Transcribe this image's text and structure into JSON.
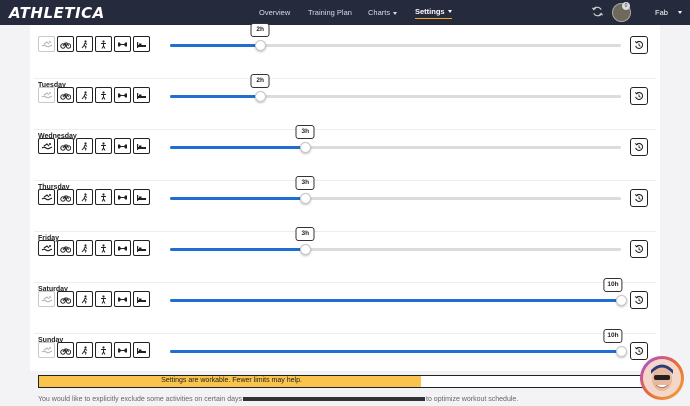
{
  "brand": "ATHLETICA",
  "nav": {
    "overview": "Overview",
    "training_plan": "Training Plan",
    "charts": "Charts",
    "settings": "Settings",
    "username": "Fab",
    "notification_count": "0"
  },
  "days": [
    {
      "name": "",
      "hours_label": "2h",
      "hours": 2,
      "swim_enabled": false
    },
    {
      "name": "Tuesday",
      "hours_label": "2h",
      "hours": 2,
      "swim_enabled": false
    },
    {
      "name": "Wednesday",
      "hours_label": "3h",
      "hours": 3,
      "swim_enabled": true
    },
    {
      "name": "Thursday",
      "hours_label": "3h",
      "hours": 3,
      "swim_enabled": true
    },
    {
      "name": "Friday",
      "hours_label": "3h",
      "hours": 3,
      "swim_enabled": true
    },
    {
      "name": "Saturday",
      "hours_label": "10h",
      "hours": 10,
      "swim_enabled": false
    },
    {
      "name": "Sunday",
      "hours_label": "10h",
      "hours": 10,
      "swim_enabled": false
    }
  ],
  "slider_max_hours": 10,
  "activity_icons": [
    "swim-icon",
    "bike-icon",
    "run-icon",
    "strength-icon",
    "weights-icon",
    "rest-icon"
  ],
  "status": {
    "message": "Settings are workable. Fewer limits may help.",
    "level": 0.63,
    "color": "#f9c44b"
  },
  "note": {
    "before": "You would like to explicitly exclude some activities on certain days",
    "after": "to optimize workout schedule."
  },
  "colors": {
    "accent": "#1f6fd1",
    "topbar": "#262a3d",
    "active_underline": "#f5a623"
  }
}
